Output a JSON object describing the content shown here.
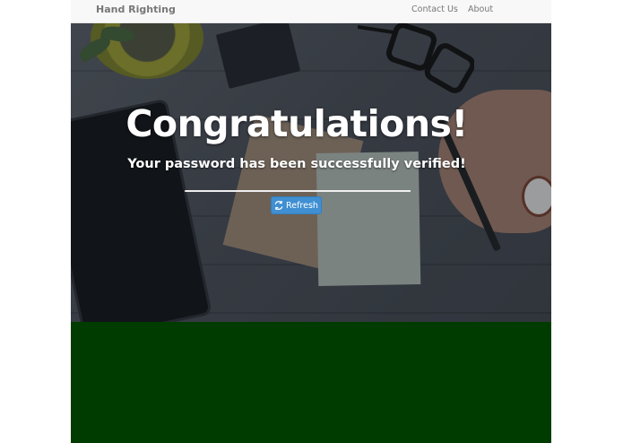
{
  "navbar": {
    "brand": "Hand Righting",
    "links": [
      {
        "label": "Contact Us"
      },
      {
        "label": "About"
      }
    ]
  },
  "hero": {
    "title": "Congratulations!",
    "subtitle": "Your password has been successfully verified!",
    "refresh_button": {
      "label": "Refresh",
      "icon": "refresh-icon"
    }
  },
  "colors": {
    "navbar_bg": "#f8f8f8",
    "button": "#3f8fd2",
    "footer_band": "#003b00"
  }
}
